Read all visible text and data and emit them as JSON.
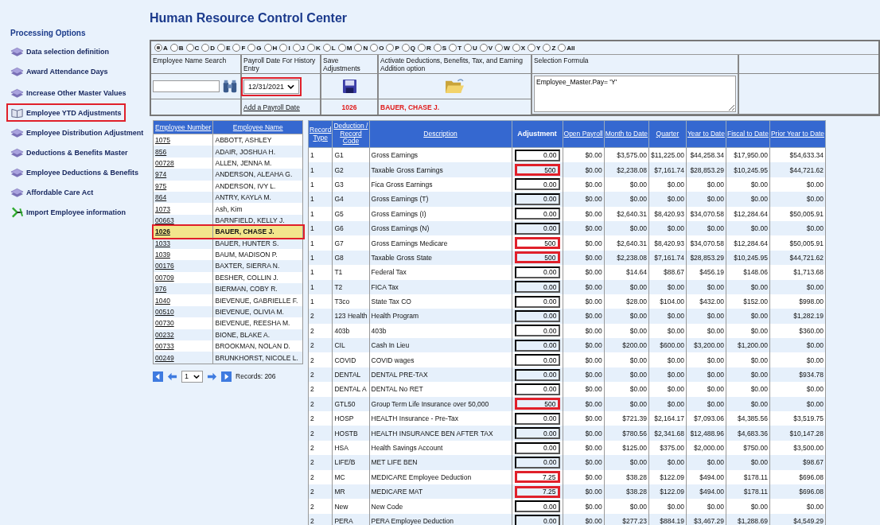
{
  "page_title": "Human Resource Control Center",
  "sidebar": {
    "heading": "Processing Options",
    "items": [
      {
        "label": "Data selection definition",
        "kind": "stack",
        "selected": false
      },
      {
        "label": "Award Attendance Days",
        "kind": "stack",
        "selected": false
      },
      {
        "label": "Increase Other Master Values",
        "kind": "stack",
        "selected": false
      },
      {
        "label": "Employee YTD Adjustments",
        "kind": "book",
        "selected": true
      },
      {
        "label": "Employee Distribution Adjustment",
        "kind": "stack",
        "selected": false
      },
      {
        "label": "Deductions & Benefits Master",
        "kind": "stack",
        "selected": false
      },
      {
        "label": "Employee Deductions & Benefits",
        "kind": "stack",
        "selected": false
      },
      {
        "label": "Affordable Care Act",
        "kind": "stack",
        "selected": false
      },
      {
        "label": "Import Employee information",
        "kind": "import",
        "selected": false
      }
    ]
  },
  "letter_filter": [
    {
      "label": "A",
      "selected": true
    },
    {
      "label": "B",
      "selected": false
    },
    {
      "label": "C",
      "selected": false
    },
    {
      "label": "D",
      "selected": false
    },
    {
      "label": "E",
      "selected": false
    },
    {
      "label": "F",
      "selected": false
    },
    {
      "label": "G",
      "selected": false
    },
    {
      "label": "H",
      "selected": false
    },
    {
      "label": "I",
      "selected": false
    },
    {
      "label": "J",
      "selected": false
    },
    {
      "label": "K",
      "selected": false
    },
    {
      "label": "L",
      "selected": false
    },
    {
      "label": "M",
      "selected": false
    },
    {
      "label": "N",
      "selected": false
    },
    {
      "label": "O",
      "selected": false
    },
    {
      "label": "P",
      "selected": false
    },
    {
      "label": "Q",
      "selected": false
    },
    {
      "label": "R",
      "selected": false
    },
    {
      "label": "S",
      "selected": false
    },
    {
      "label": "T",
      "selected": false
    },
    {
      "label": "U",
      "selected": false
    },
    {
      "label": "V",
      "selected": false
    },
    {
      "label": "W",
      "selected": false
    },
    {
      "label": "X",
      "selected": false
    },
    {
      "label": "Y",
      "selected": false
    },
    {
      "label": "Z",
      "selected": false
    },
    {
      "label": "All",
      "selected": false
    }
  ],
  "controls": {
    "name_search_label": "Employee Name Search",
    "payroll_date_label": "Payroll Date For History Entry",
    "payroll_date": "12/31/2021",
    "payroll_date_highlighted": true,
    "save_label": "Save Adjustments",
    "activate_label": "Activate Deductions, Benefits, Tax, and Earning Addition option",
    "formula_label": "Selection Formula",
    "formula": "Employee_Master.Pay= 'Y'",
    "add_payroll_link": "Add a Payroll Date",
    "current_number": "1026",
    "current_name": "BAUER, CHASE J."
  },
  "employees": {
    "columns": [
      "Employee Number",
      "Employee Name"
    ],
    "page": "1",
    "records": "Records: 206",
    "rows": [
      {
        "number": "1075",
        "name": "ABBOTT, ASHLEY",
        "selected": false
      },
      {
        "number": "856",
        "name": "ADAIR, JOSHUA H.",
        "selected": false
      },
      {
        "number": "00728",
        "name": "ALLEN, JENNA M.",
        "selected": false
      },
      {
        "number": "974",
        "name": "ANDERSON, ALEAHA G.",
        "selected": false
      },
      {
        "number": "975",
        "name": "ANDERSON, IVY L.",
        "selected": false
      },
      {
        "number": "864",
        "name": "ANTRY, KAYLA M.",
        "selected": false
      },
      {
        "number": "1073",
        "name": "Ash, Kim",
        "selected": false
      },
      {
        "number": "00663",
        "name": "BARNFIELD, KELLY J.",
        "selected": false
      },
      {
        "number": "1026",
        "name": "BAUER, CHASE J.",
        "selected": true
      },
      {
        "number": "1033",
        "name": "BAUER, HUNTER S.",
        "selected": false
      },
      {
        "number": "1039",
        "name": "BAUM, MADISON P.",
        "selected": false
      },
      {
        "number": "00176",
        "name": "BAXTER, SIERRA N.",
        "selected": false
      },
      {
        "number": "00709",
        "name": "BESHER, COLLIN J.",
        "selected": false
      },
      {
        "number": "976",
        "name": "BIERMAN, COBY R.",
        "selected": false
      },
      {
        "number": "1040",
        "name": "BIEVENUE, GABRIELLE F.",
        "selected": false
      },
      {
        "number": "00510",
        "name": "BIEVENUE, OLIVIA M.",
        "selected": false
      },
      {
        "number": "00730",
        "name": "BIEVENUE, REESHA M.",
        "selected": false
      },
      {
        "number": "00232",
        "name": "BIONE, BLAKE A.",
        "selected": false
      },
      {
        "number": "00733",
        "name": "BROOKMAN, NOLAN D.",
        "selected": false
      },
      {
        "number": "00249",
        "name": "BRUNKHORST, NICOLE L.",
        "selected": false
      }
    ]
  },
  "adjustments": {
    "columns": [
      "Record Type",
      "Deduction / Record Code",
      "Description",
      "Adjustment",
      "Open Payroll",
      "Month to Date",
      "Quarter",
      "Year to Date",
      "Fiscal to Date",
      "Prior Year to Date"
    ],
    "rows": [
      {
        "type": "1",
        "code": "G1",
        "description": "Gross Earnings",
        "adjustment": "0.00",
        "highlighted": false,
        "values": [
          "$0.00",
          "$3,575.00",
          "$11,225.00",
          "$44,258.34",
          "$17,950.00",
          "$54,633.34"
        ]
      },
      {
        "type": "1",
        "code": "G2",
        "description": "Taxable Gross Earnings",
        "adjustment": "500",
        "highlighted": true,
        "values": [
          "$0.00",
          "$2,238.08",
          "$7,161.74",
          "$28,853.29",
          "$10,245.95",
          "$44,721.62"
        ]
      },
      {
        "type": "1",
        "code": "G3",
        "description": "Fica Gross Earnings",
        "adjustment": "0.00",
        "highlighted": false,
        "values": [
          "$0.00",
          "$0.00",
          "$0.00",
          "$0.00",
          "$0.00",
          "$0.00"
        ]
      },
      {
        "type": "1",
        "code": "G4",
        "description": "Gross Earnings (T)",
        "adjustment": "0.00",
        "highlighted": false,
        "values": [
          "$0.00",
          "$0.00",
          "$0.00",
          "$0.00",
          "$0.00",
          "$0.00"
        ]
      },
      {
        "type": "1",
        "code": "G5",
        "description": "Gross Earnings (I)",
        "adjustment": "0.00",
        "highlighted": false,
        "values": [
          "$0.00",
          "$2,640.31",
          "$8,420.93",
          "$34,070.58",
          "$12,284.64",
          "$50,005.91"
        ]
      },
      {
        "type": "1",
        "code": "G6",
        "description": "Gross Earnings (N)",
        "adjustment": "0.00",
        "highlighted": false,
        "values": [
          "$0.00",
          "$0.00",
          "$0.00",
          "$0.00",
          "$0.00",
          "$0.00"
        ]
      },
      {
        "type": "1",
        "code": "G7",
        "description": "Gross Earnings Medicare",
        "adjustment": "500",
        "highlighted": true,
        "values": [
          "$0.00",
          "$2,640.31",
          "$8,420.93",
          "$34,070.58",
          "$12,284.64",
          "$50,005.91"
        ]
      },
      {
        "type": "1",
        "code": "G8",
        "description": "Taxable Gross State",
        "adjustment": "500",
        "highlighted": true,
        "values": [
          "$0.00",
          "$2,238.08",
          "$7,161.74",
          "$28,853.29",
          "$10,245.95",
          "$44,721.62"
        ]
      },
      {
        "type": "1",
        "code": "T1",
        "description": "Federal Tax",
        "adjustment": "0.00",
        "highlighted": false,
        "values": [
          "$0.00",
          "$14.64",
          "$88.67",
          "$456.19",
          "$148.06",
          "$1,713.68"
        ]
      },
      {
        "type": "1",
        "code": "T2",
        "description": "FICA Tax",
        "adjustment": "0.00",
        "highlighted": false,
        "values": [
          "$0.00",
          "$0.00",
          "$0.00",
          "$0.00",
          "$0.00",
          "$0.00"
        ]
      },
      {
        "type": "1",
        "code": "T3co",
        "description": "State Tax CO",
        "adjustment": "0.00",
        "highlighted": false,
        "values": [
          "$0.00",
          "$28.00",
          "$104.00",
          "$432.00",
          "$152.00",
          "$998.00"
        ]
      },
      {
        "type": "2",
        "code": "123 Health",
        "description": "Health Program",
        "adjustment": "0.00",
        "highlighted": false,
        "values": [
          "$0.00",
          "$0.00",
          "$0.00",
          "$0.00",
          "$0.00",
          "$1,282.19"
        ]
      },
      {
        "type": "2",
        "code": "403b",
        "description": "403b",
        "adjustment": "0.00",
        "highlighted": false,
        "values": [
          "$0.00",
          "$0.00",
          "$0.00",
          "$0.00",
          "$0.00",
          "$360.00"
        ]
      },
      {
        "type": "2",
        "code": "CIL",
        "description": "Cash In Lieu",
        "adjustment": "0.00",
        "highlighted": false,
        "values": [
          "$0.00",
          "$200.00",
          "$600.00",
          "$3,200.00",
          "$1,200.00",
          "$0.00"
        ]
      },
      {
        "type": "2",
        "code": "COVID",
        "description": "COVID wages",
        "adjustment": "0.00",
        "highlighted": false,
        "values": [
          "$0.00",
          "$0.00",
          "$0.00",
          "$0.00",
          "$0.00",
          "$0.00"
        ]
      },
      {
        "type": "2",
        "code": "DENTAL",
        "description": "DENTAL PRE-TAX",
        "adjustment": "0.00",
        "highlighted": false,
        "values": [
          "$0.00",
          "$0.00",
          "$0.00",
          "$0.00",
          "$0.00",
          "$934.78"
        ]
      },
      {
        "type": "2",
        "code": "DENTAL A",
        "description": "DENTAL No RET",
        "adjustment": "0.00",
        "highlighted": false,
        "values": [
          "$0.00",
          "$0.00",
          "$0.00",
          "$0.00",
          "$0.00",
          "$0.00"
        ]
      },
      {
        "type": "2",
        "code": "GTL50",
        "description": "Group Term Life Insurance over 50,000",
        "adjustment": "500",
        "highlighted": true,
        "values": [
          "$0.00",
          "$0.00",
          "$0.00",
          "$0.00",
          "$0.00",
          "$0.00"
        ]
      },
      {
        "type": "2",
        "code": "HOSP",
        "description": "HEALTH Insurance - Pre-Tax",
        "adjustment": "0.00",
        "highlighted": false,
        "values": [
          "$0.00",
          "$721.39",
          "$2,164.17",
          "$7,093.06",
          "$4,385.56",
          "$3,519.75"
        ]
      },
      {
        "type": "2",
        "code": "HOSTB",
        "description": "HEALTH INSURANCE BEN AFTER TAX",
        "adjustment": "0.00",
        "highlighted": false,
        "values": [
          "$0.00",
          "$780.56",
          "$2,341.68",
          "$12,488.96",
          "$4,683.36",
          "$10,147.28"
        ]
      },
      {
        "type": "2",
        "code": "HSA",
        "description": "Health Savings Account",
        "adjustment": "0.00",
        "highlighted": false,
        "values": [
          "$0.00",
          "$125.00",
          "$375.00",
          "$2,000.00",
          "$750.00",
          "$3,500.00"
        ]
      },
      {
        "type": "2",
        "code": "LIFE/B",
        "description": "MET LIFE BEN",
        "adjustment": "0.00",
        "highlighted": false,
        "values": [
          "$0.00",
          "$0.00",
          "$0.00",
          "$0.00",
          "$0.00",
          "$98.67"
        ]
      },
      {
        "type": "2",
        "code": "MC",
        "description": "MEDICARE Employee Deduction",
        "adjustment": "7.25",
        "highlighted": true,
        "values": [
          "$0.00",
          "$38.28",
          "$122.09",
          "$494.00",
          "$178.11",
          "$696.08"
        ]
      },
      {
        "type": "2",
        "code": "MR",
        "description": "MEDICARE MAT",
        "adjustment": "7.25",
        "highlighted": true,
        "values": [
          "$0.00",
          "$38.28",
          "$122.09",
          "$494.00",
          "$178.11",
          "$696.08"
        ]
      },
      {
        "type": "2",
        "code": "New",
        "description": "New Code",
        "adjustment": "0.00",
        "highlighted": false,
        "values": [
          "$0.00",
          "$0.00",
          "$0.00",
          "$0.00",
          "$0.00",
          "$0.00"
        ]
      },
      {
        "type": "2",
        "code": "PERA",
        "description": "PERA Employee Deduction",
        "adjustment": "0.00",
        "highlighted": false,
        "values": [
          "$0.00",
          "$277.23",
          "$884.19",
          "$3,467.29",
          "$1,288.69",
          "$4,549.29"
        ]
      }
    ]
  }
}
